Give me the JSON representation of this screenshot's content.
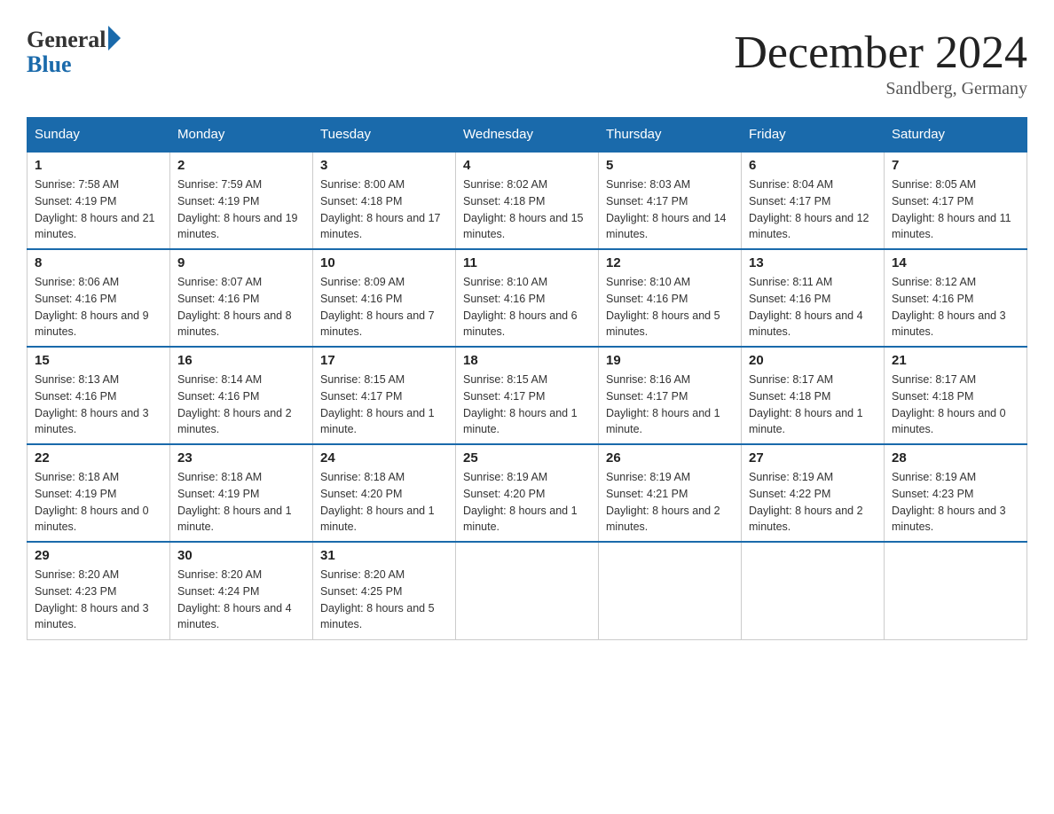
{
  "header": {
    "logo_general": "General",
    "logo_blue": "Blue",
    "month_year": "December 2024",
    "location": "Sandberg, Germany"
  },
  "days_of_week": [
    "Sunday",
    "Monday",
    "Tuesday",
    "Wednesday",
    "Thursday",
    "Friday",
    "Saturday"
  ],
  "weeks": [
    [
      {
        "day": 1,
        "sunrise": "7:58 AM",
        "sunset": "4:19 PM",
        "daylight": "8 hours and 21 minutes."
      },
      {
        "day": 2,
        "sunrise": "7:59 AM",
        "sunset": "4:19 PM",
        "daylight": "8 hours and 19 minutes."
      },
      {
        "day": 3,
        "sunrise": "8:00 AM",
        "sunset": "4:18 PM",
        "daylight": "8 hours and 17 minutes."
      },
      {
        "day": 4,
        "sunrise": "8:02 AM",
        "sunset": "4:18 PM",
        "daylight": "8 hours and 15 minutes."
      },
      {
        "day": 5,
        "sunrise": "8:03 AM",
        "sunset": "4:17 PM",
        "daylight": "8 hours and 14 minutes."
      },
      {
        "day": 6,
        "sunrise": "8:04 AM",
        "sunset": "4:17 PM",
        "daylight": "8 hours and 12 minutes."
      },
      {
        "day": 7,
        "sunrise": "8:05 AM",
        "sunset": "4:17 PM",
        "daylight": "8 hours and 11 minutes."
      }
    ],
    [
      {
        "day": 8,
        "sunrise": "8:06 AM",
        "sunset": "4:16 PM",
        "daylight": "8 hours and 9 minutes."
      },
      {
        "day": 9,
        "sunrise": "8:07 AM",
        "sunset": "4:16 PM",
        "daylight": "8 hours and 8 minutes."
      },
      {
        "day": 10,
        "sunrise": "8:09 AM",
        "sunset": "4:16 PM",
        "daylight": "8 hours and 7 minutes."
      },
      {
        "day": 11,
        "sunrise": "8:10 AM",
        "sunset": "4:16 PM",
        "daylight": "8 hours and 6 minutes."
      },
      {
        "day": 12,
        "sunrise": "8:10 AM",
        "sunset": "4:16 PM",
        "daylight": "8 hours and 5 minutes."
      },
      {
        "day": 13,
        "sunrise": "8:11 AM",
        "sunset": "4:16 PM",
        "daylight": "8 hours and 4 minutes."
      },
      {
        "day": 14,
        "sunrise": "8:12 AM",
        "sunset": "4:16 PM",
        "daylight": "8 hours and 3 minutes."
      }
    ],
    [
      {
        "day": 15,
        "sunrise": "8:13 AM",
        "sunset": "4:16 PM",
        "daylight": "8 hours and 3 minutes."
      },
      {
        "day": 16,
        "sunrise": "8:14 AM",
        "sunset": "4:16 PM",
        "daylight": "8 hours and 2 minutes."
      },
      {
        "day": 17,
        "sunrise": "8:15 AM",
        "sunset": "4:17 PM",
        "daylight": "8 hours and 1 minute."
      },
      {
        "day": 18,
        "sunrise": "8:15 AM",
        "sunset": "4:17 PM",
        "daylight": "8 hours and 1 minute."
      },
      {
        "day": 19,
        "sunrise": "8:16 AM",
        "sunset": "4:17 PM",
        "daylight": "8 hours and 1 minute."
      },
      {
        "day": 20,
        "sunrise": "8:17 AM",
        "sunset": "4:18 PM",
        "daylight": "8 hours and 1 minute."
      },
      {
        "day": 21,
        "sunrise": "8:17 AM",
        "sunset": "4:18 PM",
        "daylight": "8 hours and 0 minutes."
      }
    ],
    [
      {
        "day": 22,
        "sunrise": "8:18 AM",
        "sunset": "4:19 PM",
        "daylight": "8 hours and 0 minutes."
      },
      {
        "day": 23,
        "sunrise": "8:18 AM",
        "sunset": "4:19 PM",
        "daylight": "8 hours and 1 minute."
      },
      {
        "day": 24,
        "sunrise": "8:18 AM",
        "sunset": "4:20 PM",
        "daylight": "8 hours and 1 minute."
      },
      {
        "day": 25,
        "sunrise": "8:19 AM",
        "sunset": "4:20 PM",
        "daylight": "8 hours and 1 minute."
      },
      {
        "day": 26,
        "sunrise": "8:19 AM",
        "sunset": "4:21 PM",
        "daylight": "8 hours and 2 minutes."
      },
      {
        "day": 27,
        "sunrise": "8:19 AM",
        "sunset": "4:22 PM",
        "daylight": "8 hours and 2 minutes."
      },
      {
        "day": 28,
        "sunrise": "8:19 AM",
        "sunset": "4:23 PM",
        "daylight": "8 hours and 3 minutes."
      }
    ],
    [
      {
        "day": 29,
        "sunrise": "8:20 AM",
        "sunset": "4:23 PM",
        "daylight": "8 hours and 3 minutes."
      },
      {
        "day": 30,
        "sunrise": "8:20 AM",
        "sunset": "4:24 PM",
        "daylight": "8 hours and 4 minutes."
      },
      {
        "day": 31,
        "sunrise": "8:20 AM",
        "sunset": "4:25 PM",
        "daylight": "8 hours and 5 minutes."
      },
      null,
      null,
      null,
      null
    ]
  ]
}
